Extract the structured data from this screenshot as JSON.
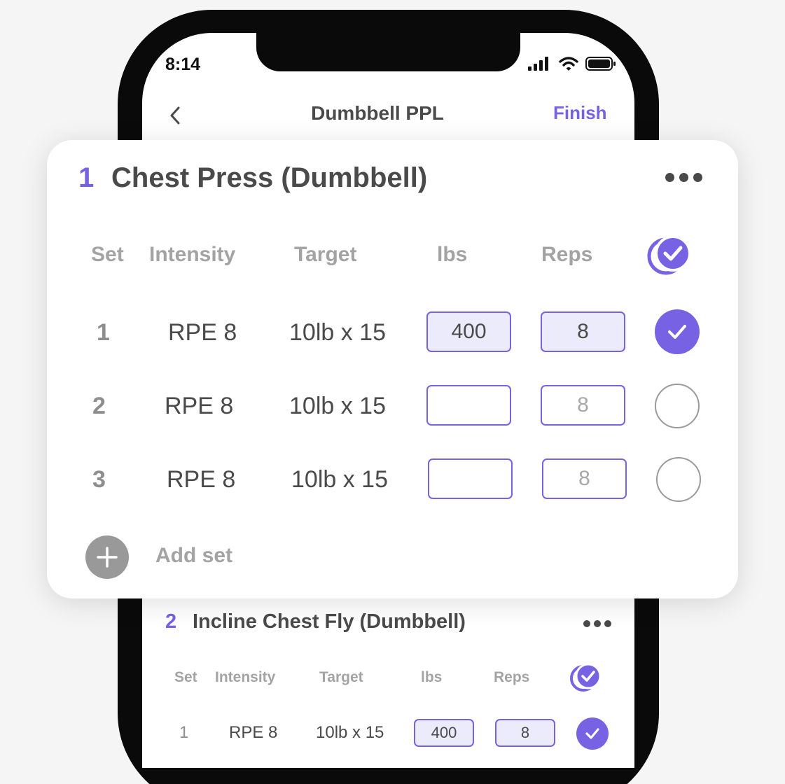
{
  "status_bar": {
    "time": "8:14"
  },
  "nav": {
    "title": "Dumbbell PPL",
    "finish_label": "Finish"
  },
  "columns": {
    "set": "Set",
    "intensity": "Intensity",
    "target": "Target",
    "weight": "lbs",
    "reps": "Reps"
  },
  "exercise1": {
    "number": "1",
    "name": "Chest Press (Dumbbell)",
    "sets": [
      {
        "set": "1",
        "intensity": "RPE 8",
        "target": "10lb x 15",
        "weight": "400",
        "reps": "8",
        "done": true
      },
      {
        "set": "2",
        "intensity": "RPE 8",
        "target": "10lb x 15",
        "weight": "",
        "reps": "8",
        "done": false
      },
      {
        "set": "3",
        "intensity": "RPE 8",
        "target": "10lb x 15",
        "weight": "",
        "reps": "8",
        "done": false
      }
    ],
    "add_set_label": "Add set"
  },
  "exercise2": {
    "number": "2",
    "name": "Incline Chest Fly (Dumbbell)",
    "sets": [
      {
        "set": "1",
        "intensity": "RPE 8",
        "target": "10lb x 15",
        "weight": "400",
        "reps": "8",
        "done": true
      }
    ]
  },
  "colors": {
    "accent": "#7662e3",
    "input_fill": "#ecebfb",
    "muted_text": "#a3a3a3"
  },
  "icons": [
    "back-chevron-icon",
    "signal-icon",
    "wifi-icon",
    "battery-icon",
    "more-icon",
    "double-check-icon",
    "check-icon",
    "plus-icon"
  ]
}
